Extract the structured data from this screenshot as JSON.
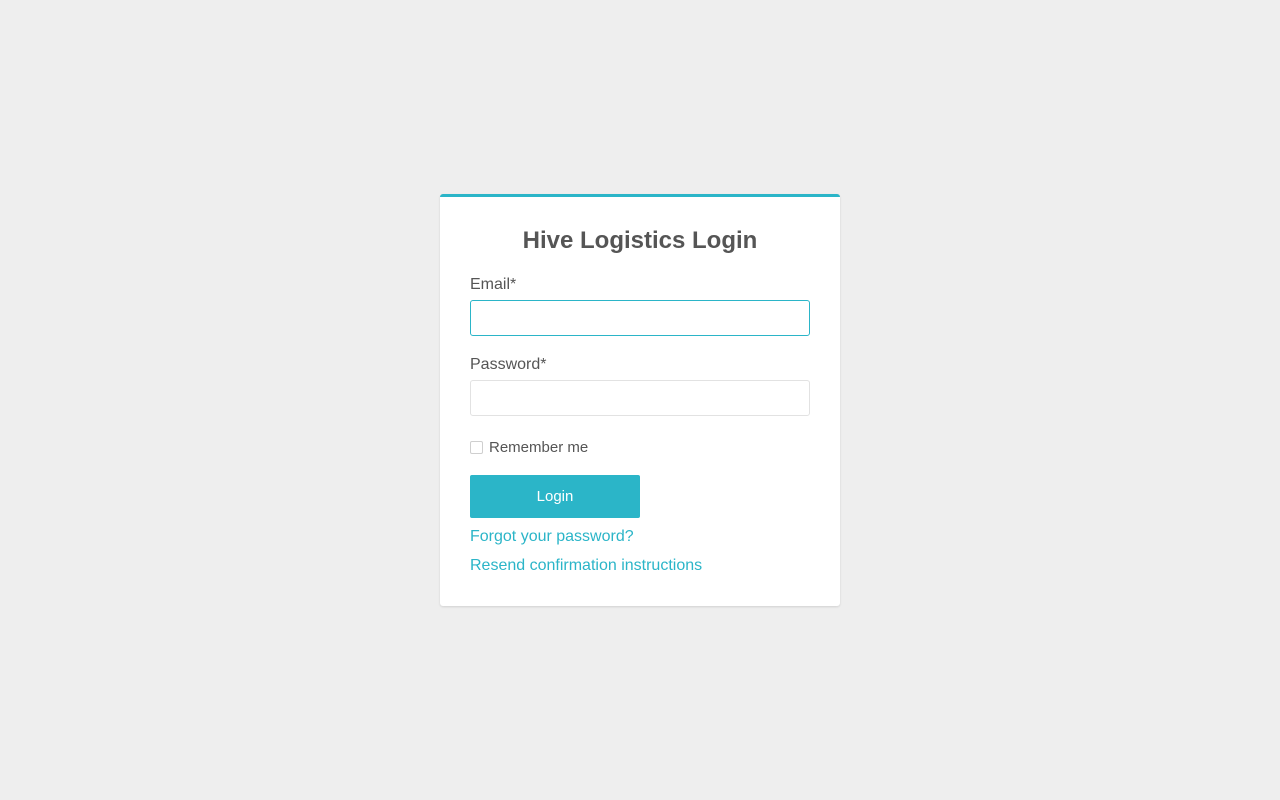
{
  "login_card": {
    "title": "Hive Logistics Login",
    "email_label": "Email*",
    "email_value": "",
    "password_label": "Password*",
    "password_value": "",
    "remember_label": "Remember me",
    "remember_checked": false,
    "login_button_label": "Login",
    "forgot_password_link": "Forgot your password?",
    "resend_confirmation_link": "Resend confirmation instructions"
  },
  "colors": {
    "accent": "#2bb5c8",
    "background": "#eeeeee",
    "card": "#ffffff",
    "text": "#555555"
  }
}
